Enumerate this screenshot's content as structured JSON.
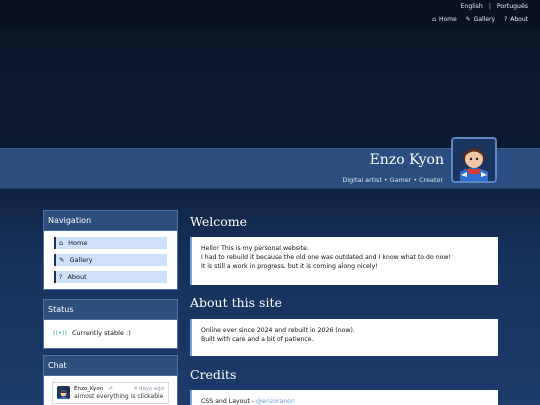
{
  "topbar": {
    "languages": [
      "English",
      "Português"
    ],
    "separator": "|",
    "nav": [
      {
        "label": "Home",
        "icon": "home-icon"
      },
      {
        "label": "Gallery",
        "icon": "brush-icon"
      },
      {
        "label": "About",
        "icon": "question-icon"
      }
    ]
  },
  "header": {
    "title": "Enzo Kyon",
    "subtitle": "Digital artist • Gamer • Creator"
  },
  "sidebar": {
    "navigation": {
      "title": "Navigation",
      "items": [
        {
          "label": "Home",
          "icon": "home-icon"
        },
        {
          "label": "Gallery",
          "icon": "brush-icon"
        },
        {
          "label": "About",
          "icon": "question-icon"
        }
      ]
    },
    "status": {
      "title": "Status",
      "text": "Currently stable :)"
    },
    "chat": {
      "title": "Chat",
      "messages": [
        {
          "user": "Enzo_Kyon",
          "time": "4 days ago",
          "text": "almost everything is clickable"
        }
      ]
    }
  },
  "main": {
    "welcome": {
      "title": "Welcome",
      "lines": [
        "Hello! This is my personal website.",
        "I had to rebuild it because the old one was outdated and I know what to do now!",
        "It is still a work in progress, but it is coming along nicely!"
      ]
    },
    "about": {
      "title": "About this site",
      "lines": [
        "Online ever since 2024 and rebuilt in 2026 (now).",
        "Built with care and a bit of patience."
      ]
    },
    "credits": {
      "title": "Credits",
      "line_label": "CSS and Layout",
      "line_value": "@enzoranon"
    }
  },
  "colors": {
    "accent": "#2e4e7e",
    "nav_item_bg": "#cfe0fb",
    "status_icon": "#3aa79a"
  }
}
